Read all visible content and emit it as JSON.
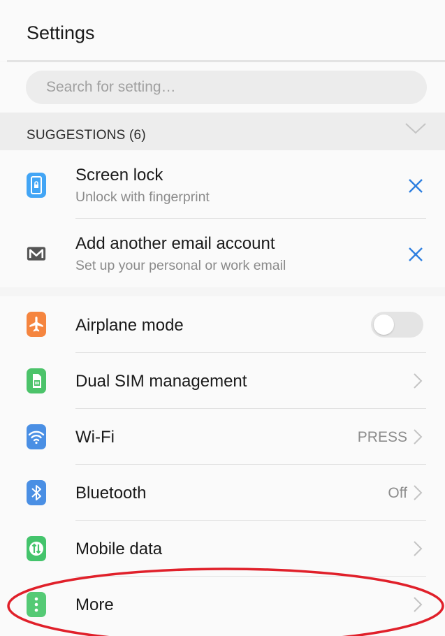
{
  "header": {
    "title": "Settings"
  },
  "search": {
    "placeholder": "Search for setting…"
  },
  "suggestions": {
    "title": "SUGGESTIONS (6)",
    "items": [
      {
        "title": "Screen lock",
        "subtitle": "Unlock with fingerprint",
        "icon": "phone-lock-icon",
        "color": "#42a5f5"
      },
      {
        "title": "Add another email account",
        "subtitle": "Set up your personal or work email",
        "icon": "email-icon",
        "color": "#555555"
      }
    ]
  },
  "settings": {
    "items": [
      {
        "title": "Airplane mode",
        "icon": "airplane-icon",
        "color": "#f5853f",
        "control": "toggle",
        "toggle_on": false
      },
      {
        "title": "Dual SIM management",
        "icon": "sim-card-icon",
        "color": "#4cc36a",
        "control": "chevron"
      },
      {
        "title": "Wi-Fi",
        "value": "PRESS",
        "icon": "wifi-icon",
        "color": "#4a8fe4",
        "control": "chevron"
      },
      {
        "title": "Bluetooth",
        "value": "Off",
        "icon": "bluetooth-icon",
        "color": "#4a8fe4",
        "control": "chevron"
      },
      {
        "title": "Mobile data",
        "icon": "mobile-data-icon",
        "color": "#44c46c",
        "control": "chevron"
      },
      {
        "title": "More",
        "icon": "more-dots-icon",
        "color": "#55ca75",
        "control": "chevron"
      }
    ]
  },
  "annotation": {
    "color": "#e0202a"
  }
}
